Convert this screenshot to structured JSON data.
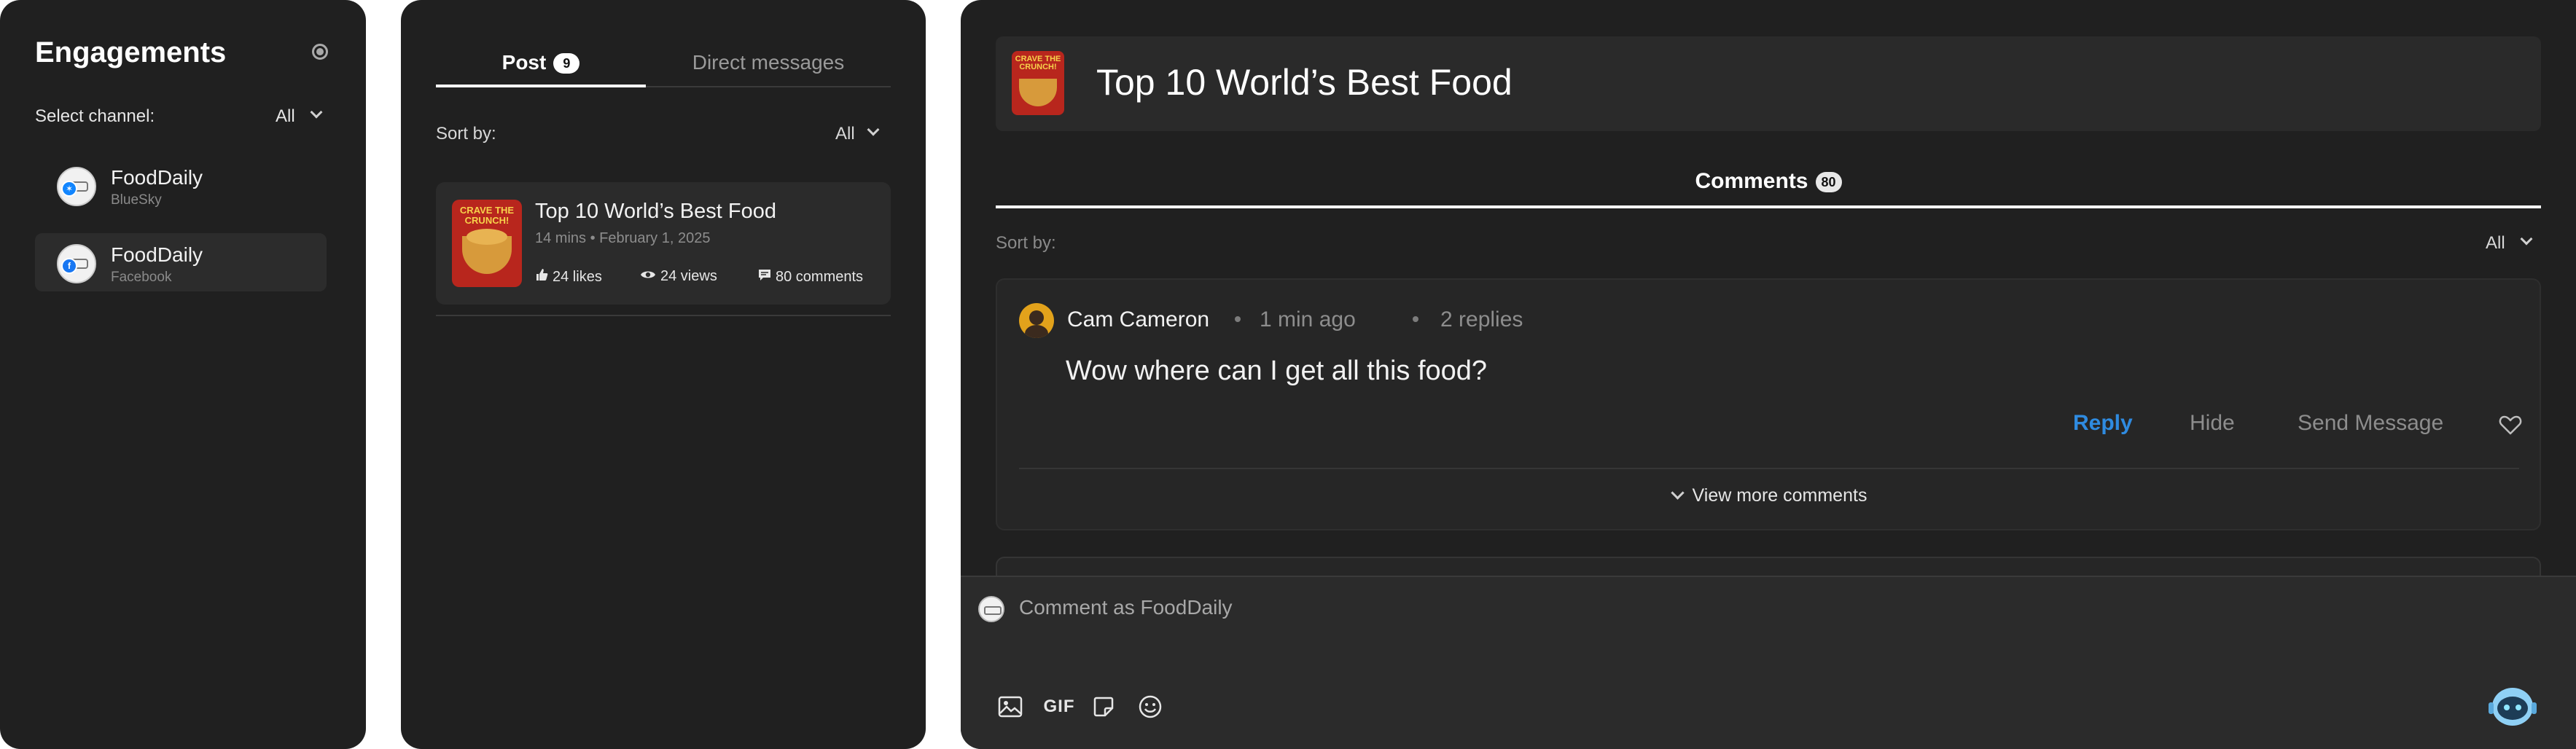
{
  "engagements": {
    "title": "Engagements",
    "select_channel_label": "Select channel:",
    "select_channel_value": "All",
    "channels": [
      {
        "name": "FoodDaily",
        "platform": "BlueSky",
        "badge_color": "#1185fe"
      },
      {
        "name": "FoodDaily",
        "platform": "Facebook",
        "badge_color": "#1877f2"
      }
    ]
  },
  "posts_panel": {
    "tab_post_label": "Post",
    "tab_post_count": "9",
    "tab_dm_label": "Direct messages",
    "sort_label": "Sort by:",
    "sort_value": "All",
    "post": {
      "title": "Top 10 World’s Best Food",
      "meta": "14 mins • February 1, 2025",
      "likes": "24 likes",
      "views": "24 views",
      "comments": "80 comments",
      "thumb_text": "CRAVE THE CRUNCH!"
    }
  },
  "detail": {
    "title": "Top 10 World’s Best Food",
    "thumb_text": "CRAVE THE CRUNCH!",
    "comments_tab_label": "Comments",
    "comments_count": "80",
    "sort_label": "Sort by:",
    "sort_value": "All",
    "comment": {
      "author": "Cam Cameron",
      "time": "1 min ago",
      "replies": "2 replies",
      "text": "Wow where can I get all this food?",
      "reply_label": "Reply",
      "hide_label": "Hide",
      "send_label": "Send Message",
      "view_more_label": "View more comments"
    },
    "composer": {
      "placeholder": "Comment as FoodDaily",
      "gif_label": "GIF"
    }
  },
  "colors": {
    "panel_bg": "#202020",
    "card_bg": "#2b2b2b",
    "accent_blue": "#2f8be0",
    "muted_text": "#8d8d8d"
  }
}
